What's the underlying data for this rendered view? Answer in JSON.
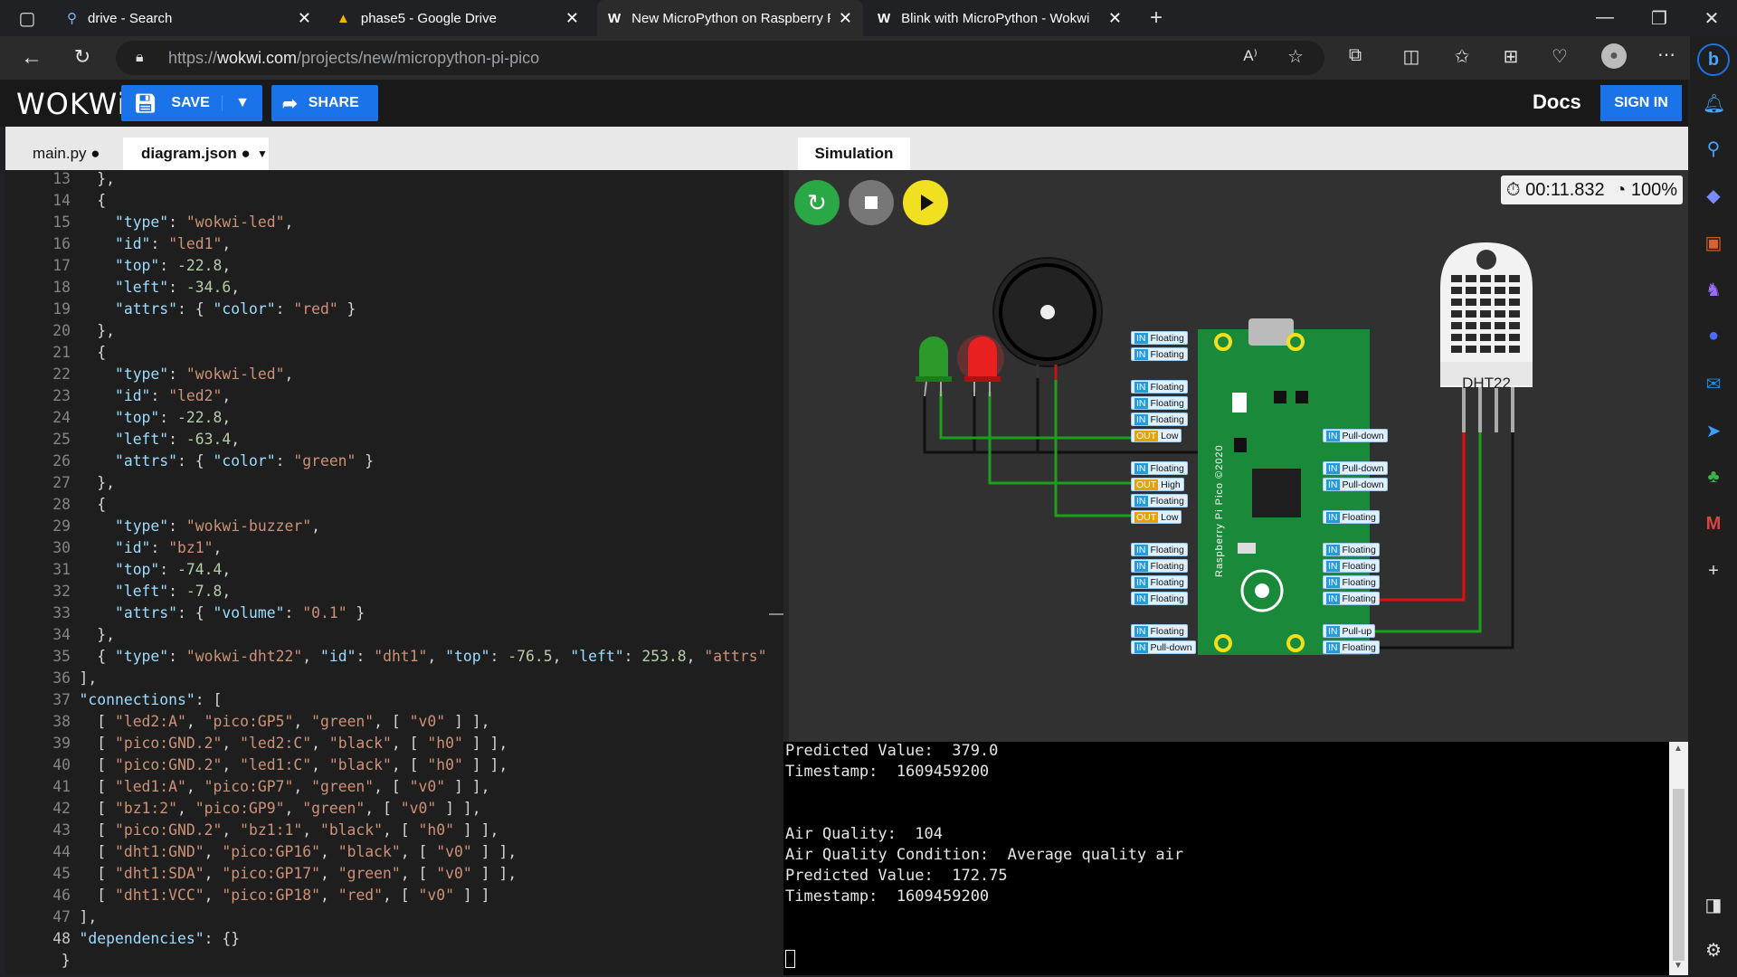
{
  "browser_tabs": [
    {
      "title": "drive - Search",
      "icon": "search-icon"
    },
    {
      "title": "phase5 - Google Drive",
      "icon": "google-drive-icon"
    },
    {
      "title": "New MicroPython on Raspberry Pi Pico - Wokwi",
      "icon": "wokwi-icon"
    },
    {
      "title": "Blink with MicroPython - Wokwi",
      "icon": "wokwi-icon"
    }
  ],
  "address": {
    "prefix": "https://",
    "domain": "wokwi.com",
    "path": "/projects/new/micropython-pi-pico"
  },
  "wokwi": {
    "logo": "WOKWi",
    "save": "SAVE",
    "share": "SHARE",
    "docs": "Docs",
    "signin": "SIGN IN"
  },
  "editor_tabs": [
    {
      "label": "main.py ●"
    },
    {
      "label": "diagram.json ●"
    }
  ],
  "line_numbers": [
    "13",
    "14",
    "15",
    "16",
    "17",
    "18",
    "19",
    "20",
    "21",
    "22",
    "23",
    "24",
    "25",
    "26",
    "27",
    "28",
    "29",
    "30",
    "31",
    "32",
    "33",
    "34",
    "35",
    "36",
    "37",
    "38",
    "39",
    "40",
    "41",
    "42",
    "43",
    "44",
    "45",
    "46",
    "47",
    "48"
  ],
  "code_lines": [
    "      },",
    "      {",
    "        \"type\": \"wokwi-led\",",
    "        \"id\": \"led1\",",
    "        \"top\": -22.8,",
    "        \"left\": -34.6,",
    "        \"attrs\": { \"color\": \"red\" }",
    "      },",
    "      {",
    "        \"type\": \"wokwi-led\",",
    "        \"id\": \"led2\",",
    "        \"top\": -22.8,",
    "        \"left\": -63.4,",
    "        \"attrs\": { \"color\": \"green\" }",
    "      },",
    "      {",
    "        \"type\": \"wokwi-buzzer\",",
    "        \"id\": \"bz1\",",
    "        \"top\": -74.4,",
    "        \"left\": -7.8,",
    "        \"attrs\": { \"volume\": \"0.1\" }",
    "      },",
    "      { \"type\": \"wokwi-dht22\", \"id\": \"dht1\", \"top\": -76.5, \"left\": 253.8, \"attrs\"",
    "    ],",
    "    \"connections\": [",
    "      [ \"led2:A\", \"pico:GP5\", \"green\", [ \"v0\" ] ],",
    "      [ \"pico:GND.2\", \"led2:C\", \"black\", [ \"h0\" ] ],",
    "      [ \"pico:GND.2\", \"led1:C\", \"black\", [ \"h0\" ] ],",
    "      [ \"led1:A\", \"pico:GP7\", \"green\", [ \"v0\" ] ],",
    "      [ \"bz1:2\", \"pico:GP9\", \"green\", [ \"v0\" ] ],",
    "      [ \"pico:GND.2\", \"bz1:1\", \"black\", [ \"h0\" ] ],",
    "      [ \"dht1:GND\", \"pico:GP16\", \"black\", [ \"v0\" ] ],",
    "      [ \"dht1:SDA\", \"pico:GP17\", \"green\", [ \"v0\" ] ],",
    "      [ \"dht1:VCC\", \"pico:GP18\", \"red\", [ \"v0\" ] ]",
    "    ],",
    "    \"dependencies\": {}",
    "  }"
  ],
  "simulation": {
    "tab": "Simulation",
    "timer": "00:11.832",
    "speed": "100%",
    "dht_label": "DHT22",
    "pico_label": "Raspberry Pi Pico ©2020"
  },
  "pins_left": [
    {
      "dir": "IN",
      "state": "Floating"
    },
    {
      "dir": "IN",
      "state": "Floating"
    },
    {
      "dir": "IN",
      "state": "Floating"
    },
    {
      "dir": "IN",
      "state": "Floating"
    },
    {
      "dir": "IN",
      "state": "Floating"
    },
    {
      "dir": "OUT",
      "state": "Low"
    },
    {
      "dir": "IN",
      "state": "Floating"
    },
    {
      "dir": "OUT",
      "state": "High"
    },
    {
      "dir": "IN",
      "state": "Floating"
    },
    {
      "dir": "OUT",
      "state": "Low"
    },
    {
      "dir": "IN",
      "state": "Floating"
    },
    {
      "dir": "IN",
      "state": "Floating"
    },
    {
      "dir": "IN",
      "state": "Floating"
    },
    {
      "dir": "IN",
      "state": "Floating"
    },
    {
      "dir": "IN",
      "state": "Floating"
    },
    {
      "dir": "IN",
      "state": "Pull-down"
    }
  ],
  "pins_right": [
    {
      "dir": "IN",
      "state": "Pull-down"
    },
    {
      "dir": "IN",
      "state": "Pull-down"
    },
    {
      "dir": "IN",
      "state": "Pull-down"
    },
    {
      "dir": "IN",
      "state": "Floating"
    },
    {
      "dir": "IN",
      "state": "Floating"
    },
    {
      "dir": "IN",
      "state": "Floating"
    },
    {
      "dir": "IN",
      "state": "Floating"
    },
    {
      "dir": "IN",
      "state": "Floating"
    },
    {
      "dir": "IN",
      "state": "Pull-up"
    },
    {
      "dir": "IN",
      "state": "Floating"
    }
  ],
  "console_lines": [
    "Predicted Value:  379.0",
    "Timestamp:  1609459200",
    "",
    "",
    "Air Quality:  104",
    "Air Quality Condition:  Average quality air",
    "Predicted Value:  172.75",
    "Timestamp:  1609459200"
  ],
  "colors": {
    "wokwi_blue": "#1a73e8",
    "wire_green": "#1aa01a",
    "wire_red": "#e01010",
    "play_yellow": "#f0e020",
    "restart_green": "#2aa845"
  }
}
